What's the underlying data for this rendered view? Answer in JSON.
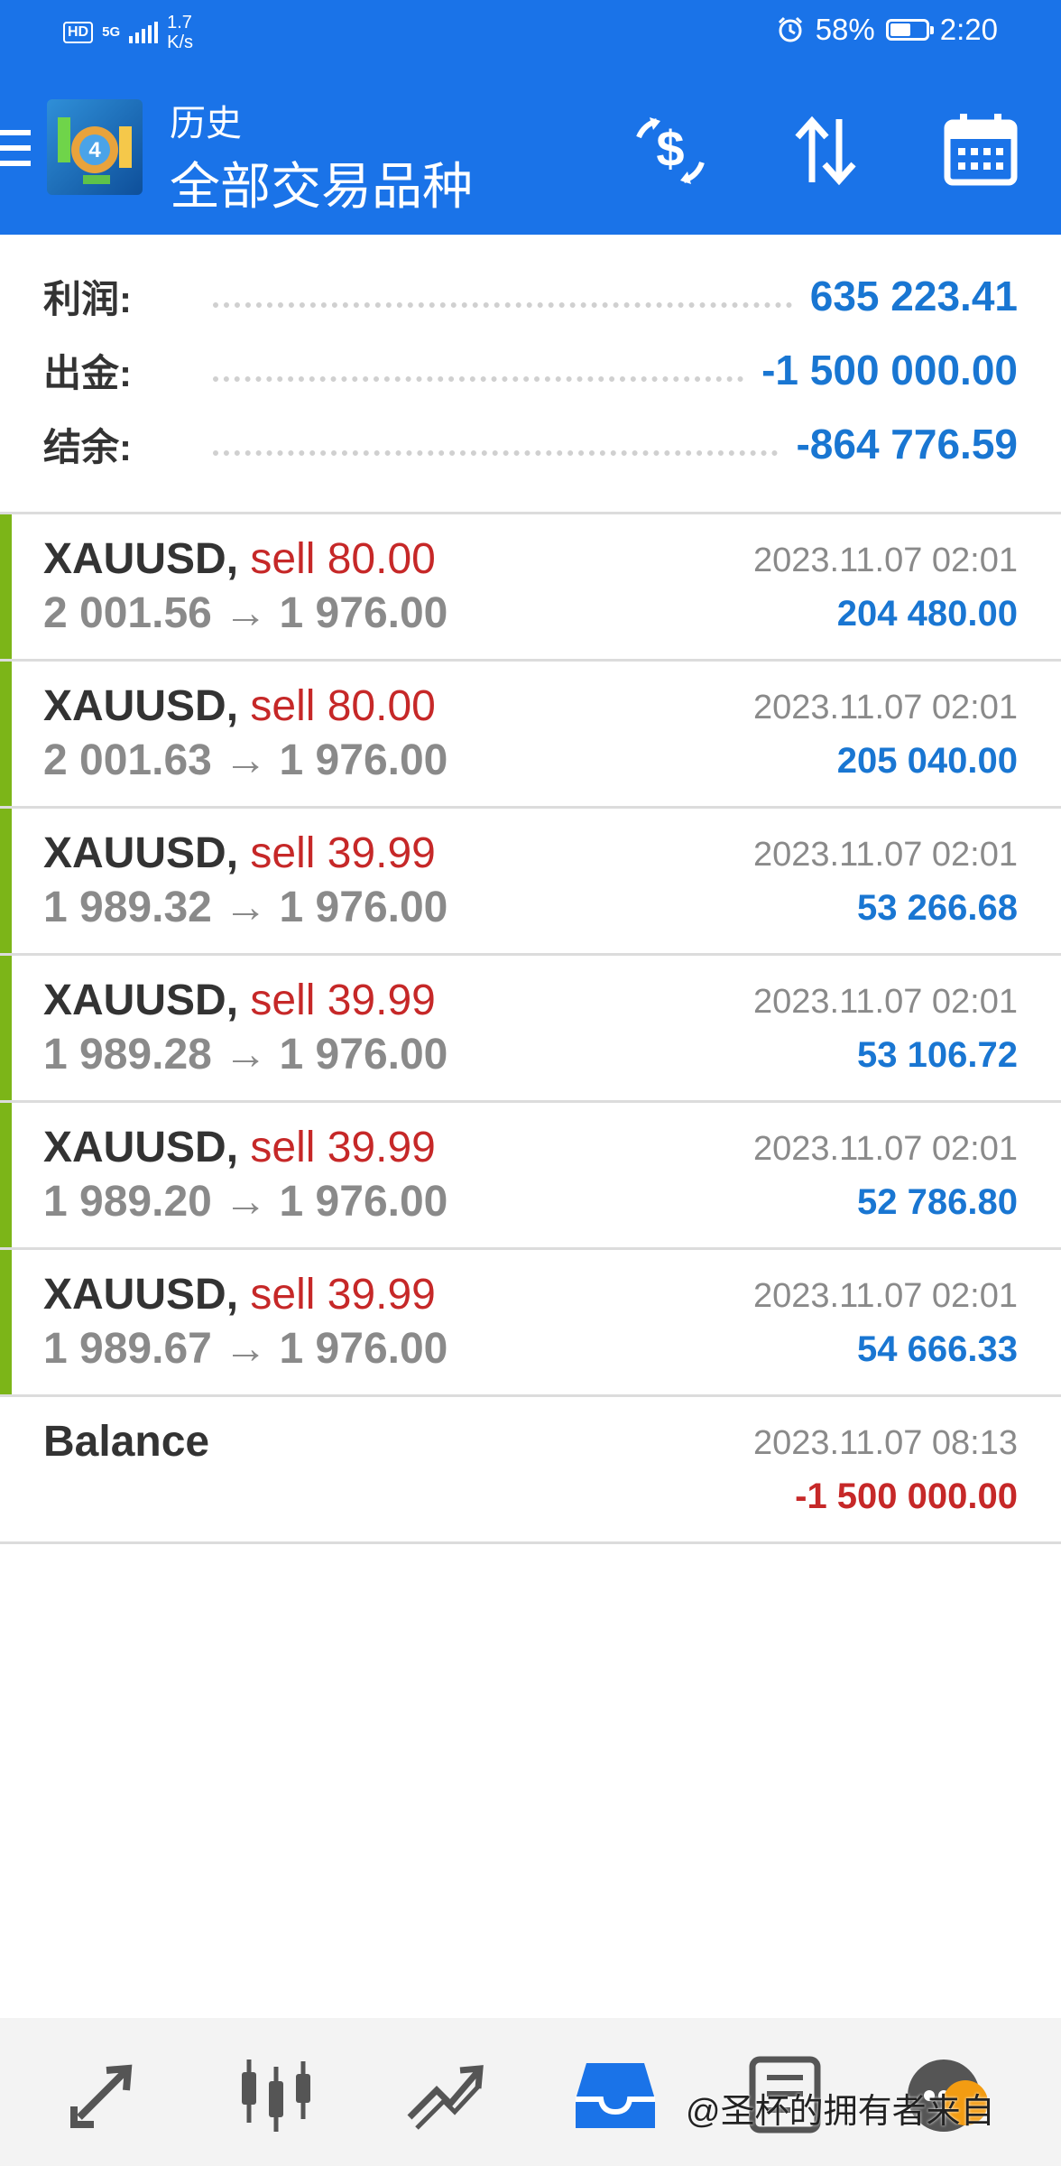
{
  "status_bar": {
    "hd": "HD",
    "network": "5G",
    "speed_value": "1.7",
    "speed_unit": "K/s",
    "battery": "58%",
    "battery_level": 0.58,
    "time": "2:20"
  },
  "app_bar": {
    "title_small": "历史",
    "title_big": "全部交易品种",
    "icons": [
      "menu-icon",
      "app-logo",
      "currency-exchange-icon",
      "sort-icon",
      "calendar-icon"
    ]
  },
  "summary": {
    "profit_label": "利润:",
    "profit_value": "635 223.41",
    "withdraw_label": "出金:",
    "withdraw_value": "-1 500 000.00",
    "balance_label": "结余:",
    "balance_value": "-864 776.59"
  },
  "trades": [
    {
      "symbol": "XAUUSD,",
      "side": "sell 80.00",
      "prices": "2 001.56 → 1 976.00",
      "time": "2023.11.07 02:01",
      "profit": "204 480.00"
    },
    {
      "symbol": "XAUUSD,",
      "side": "sell 80.00",
      "prices": "2 001.63 → 1 976.00",
      "time": "2023.11.07 02:01",
      "profit": "205 040.00"
    },
    {
      "symbol": "XAUUSD,",
      "side": "sell 39.99",
      "prices": "1 989.32 → 1 976.00",
      "time": "2023.11.07 02:01",
      "profit": "53 266.68"
    },
    {
      "symbol": "XAUUSD,",
      "side": "sell 39.99",
      "prices": "1 989.28 → 1 976.00",
      "time": "2023.11.07 02:01",
      "profit": "53 106.72"
    },
    {
      "symbol": "XAUUSD,",
      "side": "sell 39.99",
      "prices": "1 989.20 → 1 976.00",
      "time": "2023.11.07 02:01",
      "profit": "52 786.80"
    },
    {
      "symbol": "XAUUSD,",
      "side": "sell 39.99",
      "prices": "1 989.67 → 1 976.00",
      "time": "2023.11.07 02:01",
      "profit": "54 666.33"
    }
  ],
  "balance_entry": {
    "label": "Balance",
    "time": "2023.11.07 08:13",
    "amount": "-1 500 000.00"
  },
  "bottom_nav": [
    "quotes-icon",
    "chart-candles-icon",
    "trade-icon",
    "history-icon",
    "news-icon",
    "messages-icon"
  ],
  "watermark": "@圣杯的拥有者来自",
  "colors": {
    "primary": "#1a73e8",
    "profit_blue": "#1976d2",
    "loss_red": "#c62828",
    "buy_bar_green": "#7cb518"
  }
}
